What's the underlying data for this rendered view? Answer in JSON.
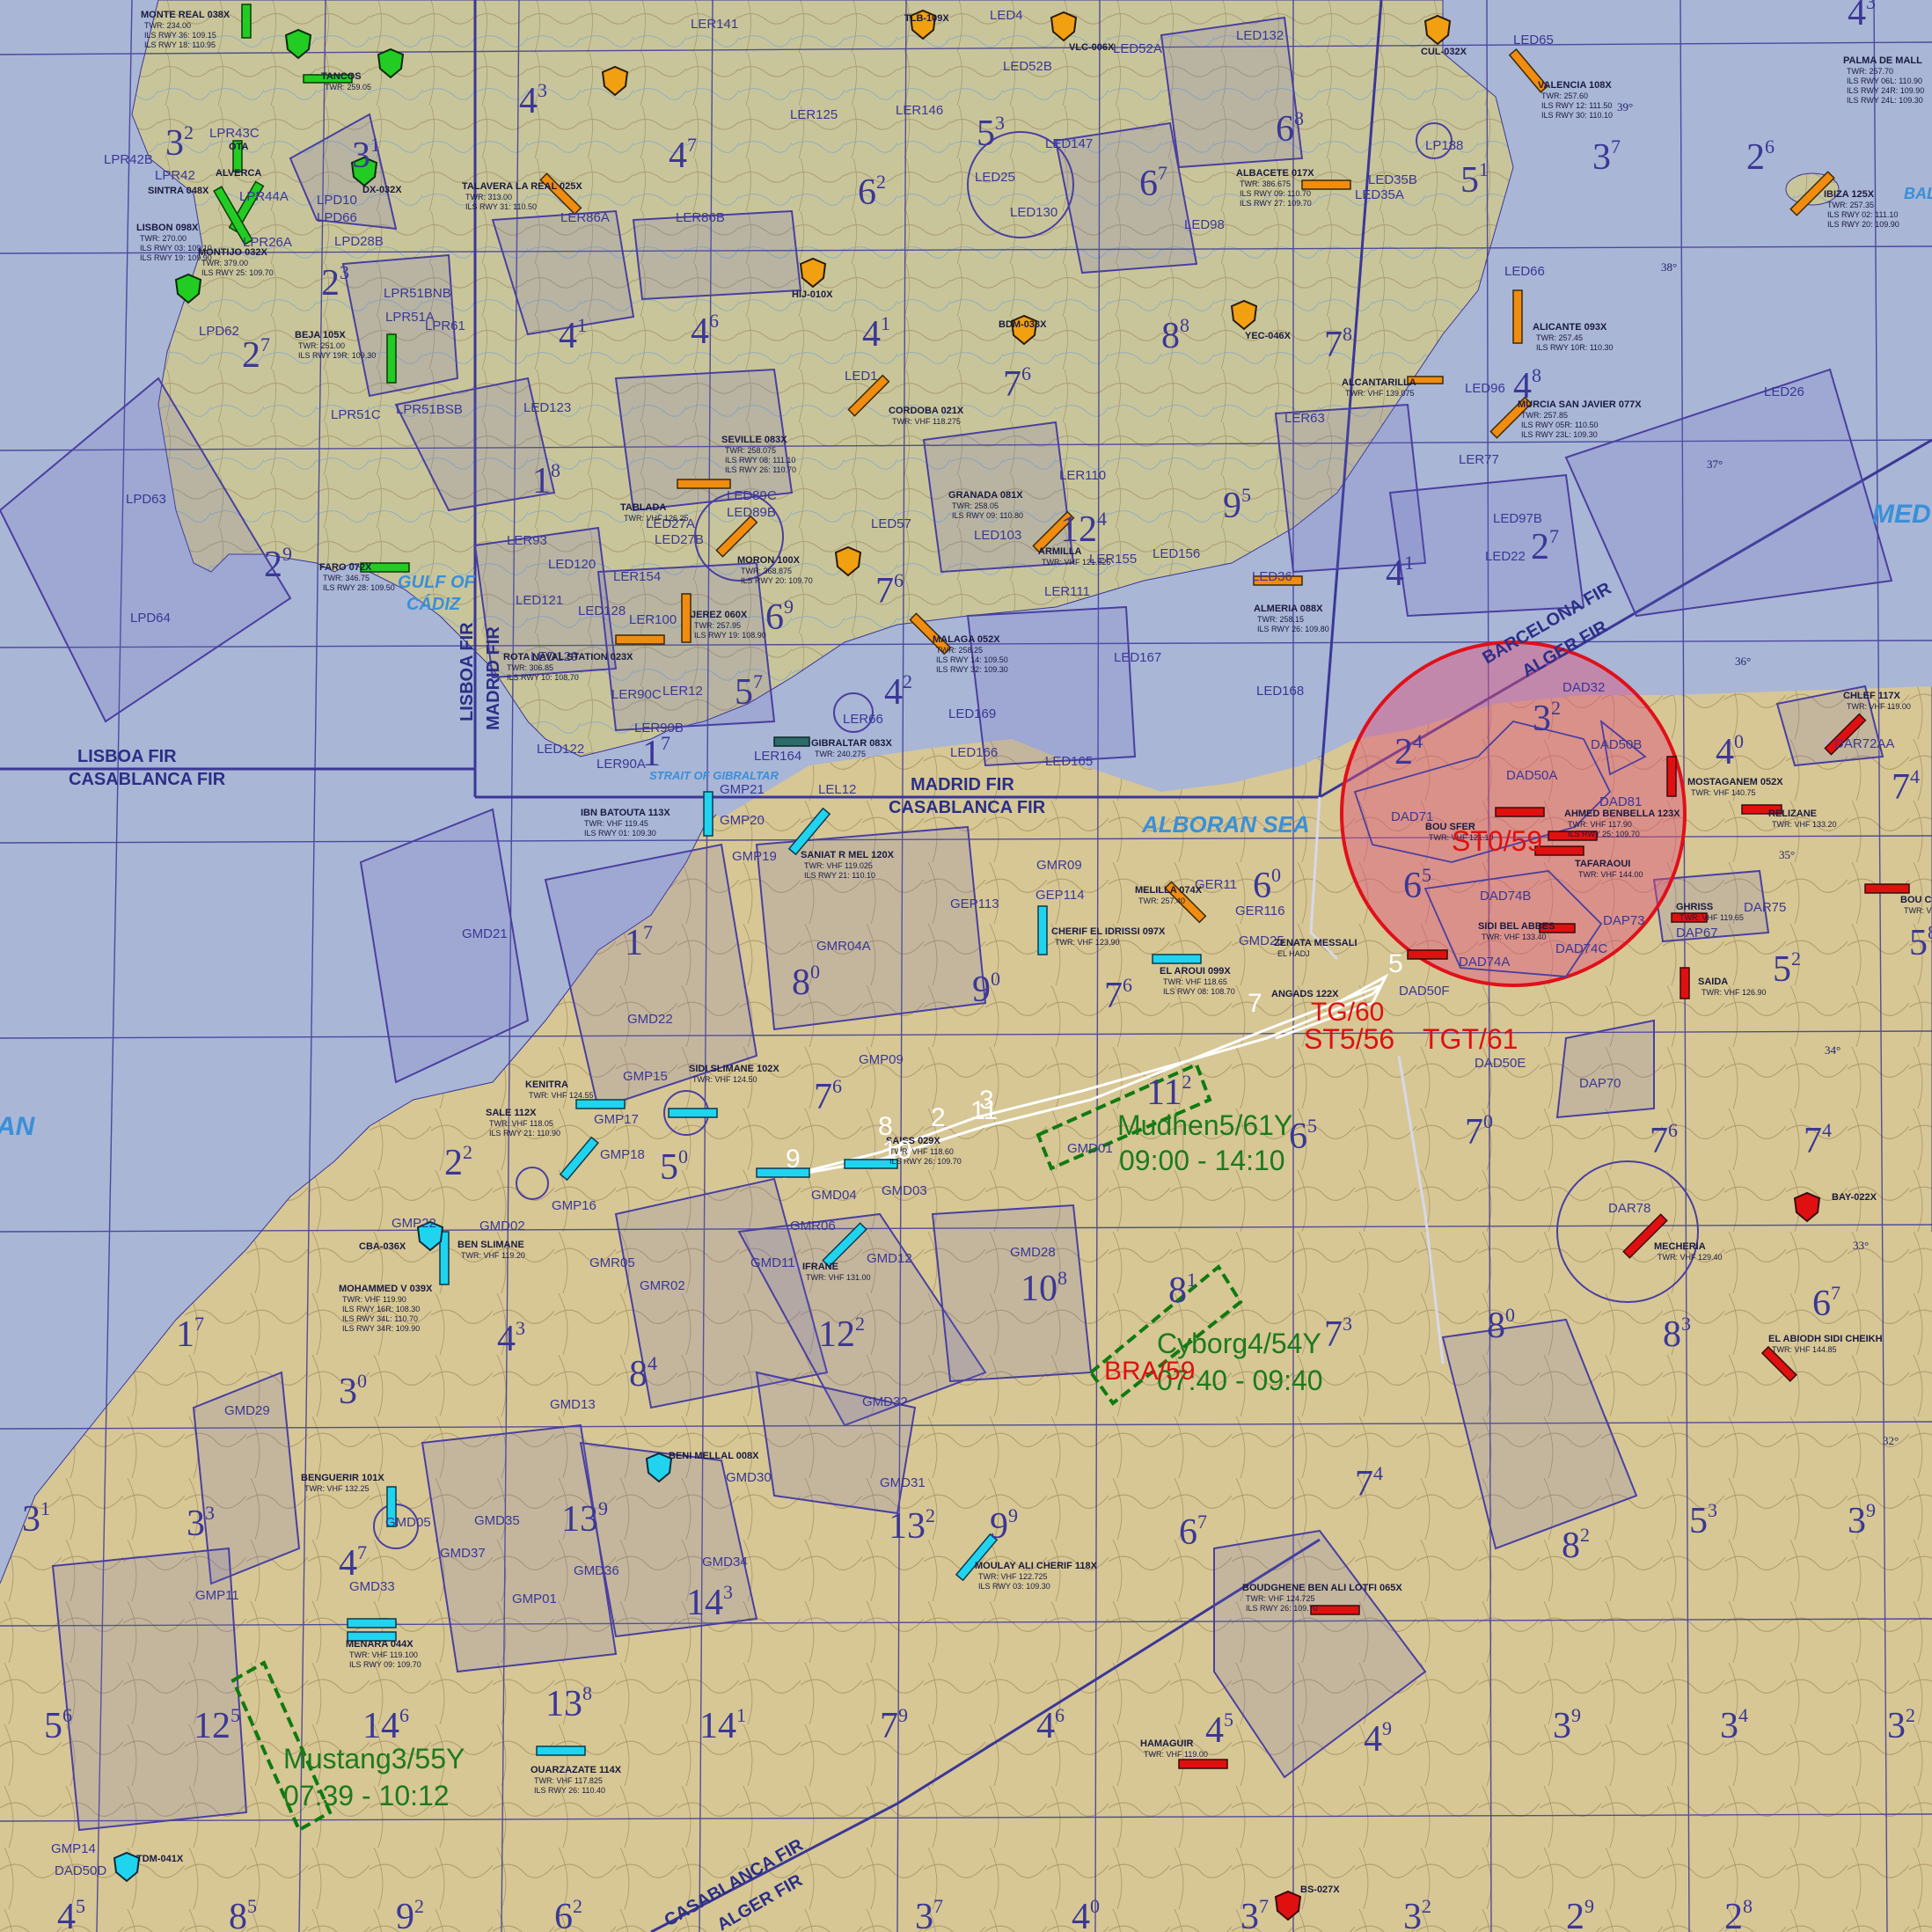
{
  "fir_labels": [
    {
      "id": "lisboa-fir",
      "text": "LISBOA FIR"
    },
    {
      "id": "casablanca-fir-w",
      "text": "CASABLANCA FIR"
    },
    {
      "id": "madrid-fir",
      "text": "MADRID FIR"
    },
    {
      "id": "casablanca-fir-c",
      "text": "CASABLANCA FIR"
    },
    {
      "id": "lisboa-fir-v",
      "text": "LISBOA FIR"
    },
    {
      "id": "madrid-fir-v",
      "text": "MADRID FIR"
    },
    {
      "id": "barcelona-fir",
      "text": "BARCELONA FIR"
    },
    {
      "id": "alger-fir",
      "text": "ALGER FIR"
    },
    {
      "id": "casablanca-fir-s",
      "text": "CASABLANCA FIR"
    },
    {
      "id": "alger-fir-s",
      "text": "ALGER FIR"
    }
  ],
  "sea_labels": [
    {
      "id": "gulf-of-cadiz-1",
      "text": "GULF OF"
    },
    {
      "id": "gulf-of-cadiz-2",
      "text": "CÁDIZ"
    },
    {
      "id": "alboran-sea",
      "text": "ALBORAN SEA"
    },
    {
      "id": "strait",
      "text": "STRAIT OF GIBRALTAR"
    },
    {
      "id": "med",
      "text": "MED"
    },
    {
      "id": "bal",
      "text": "BAL"
    },
    {
      "id": "atlantic",
      "text": "AN"
    }
  ],
  "latitudes": [
    "39°",
    "38°",
    "37°",
    "36°",
    "35°",
    "34°",
    "33°",
    "32°"
  ],
  "zones": [
    "LER141",
    "LED4",
    "LED52A",
    "LED132",
    "LED65",
    "LED52B",
    "LER125",
    "LER146",
    "LED147",
    "LP188",
    "LED35B",
    "LED35A",
    "LPR42B",
    "LPR43C",
    "LPR44A",
    "LPR42",
    "LPD10",
    "LPD66",
    "LPD28B",
    "LPR26A",
    "LER86A",
    "LER86B",
    "LED25",
    "LED130",
    "LED98",
    "LED66",
    "LPR51BNB",
    "LPR51A",
    "LPR61",
    "LPD62",
    "LPR51C",
    "LPR51BSB",
    "LED123",
    "LED1",
    "LER63",
    "LED26",
    "LED96",
    "LER77",
    "LPD63",
    "LPD64",
    "LED27A",
    "LED27B",
    "LED89C",
    "LED89B",
    "LED57",
    "LED103",
    "LER110",
    "LER155",
    "LED156",
    "LER111",
    "LED36",
    "LED97B",
    "LED22",
    "LER93",
    "LED120",
    "LER154",
    "LED121",
    "LED128",
    "LER100",
    "LED129",
    "LER12",
    "LER90C",
    "LER90B",
    "LED122",
    "LER90A",
    "LER164",
    "LER66",
    "LED169",
    "LED166",
    "LED165",
    "LED167",
    "LED168",
    "LEL12",
    "GMP21",
    "GMP20",
    "GMP19",
    "GMR09",
    "GEP113",
    "GEP114",
    "GER11",
    "GER116",
    "GMD25",
    "GMD21",
    "GMR04A",
    "GMD22",
    "GMP09",
    "GMP15",
    "GMP17",
    "GMP18",
    "GMP16",
    "GMP22",
    "GMD02",
    "GMD04",
    "GMD03",
    "GMD01",
    "GMR06",
    "GMR05",
    "GMR02",
    "GMD11",
    "GMD12",
    "GMD28",
    "GMD29",
    "GMD13",
    "GMD32",
    "GMD31",
    "GMD30",
    "GMD34",
    "GMD35",
    "GMD37",
    "GMD36",
    "GMP01",
    "GMD05",
    "GMD33",
    "GMP11",
    "GMP14",
    "DAD50D",
    "DAD32",
    "DAD50B",
    "DAD50A",
    "DAD71",
    "DAD81",
    "DAD74B",
    "DAD74A",
    "DAD74C",
    "DAP73",
    "DAD50F",
    "DAD50E",
    "DAP70",
    "DAR78",
    "DAR72AA",
    "DAR75",
    "DAP67"
  ],
  "airbases": [
    {
      "id": "monte-real",
      "text": "MONTE REAL 038X",
      "info": [
        "TWR: 234.00",
        "ILS RWY 36: 109.15",
        "ILS RWY 18: 110.95"
      ]
    },
    {
      "id": "sintra",
      "text": "SINTRA 048X"
    },
    {
      "id": "lisbon",
      "text": "LISBON 098X",
      "info": [
        "TWR: 270.00",
        "ILS RWY 03: 109.10",
        "ILS RWY 19: 109.90"
      ]
    },
    {
      "id": "montijo",
      "text": "MONTIJO 032X",
      "info": [
        "TWR: 379.00",
        "ILS RWY 25: 109.70"
      ]
    },
    {
      "id": "alverca",
      "text": "ALVERCA"
    },
    {
      "id": "ota",
      "text": "OTA"
    },
    {
      "id": "tancos",
      "text": "TANCOS",
      "info": [
        "TWR: 259.05"
      ]
    },
    {
      "id": "beja",
      "text": "BEJA 105X",
      "info": [
        "TWR: 251.00",
        "ILS RWY 19R: 109.30"
      ]
    },
    {
      "id": "faro",
      "text": "FARO 072X",
      "info": [
        "TWR: 346.75",
        "ILS RWY 28: 109.50"
      ]
    },
    {
      "id": "talavera",
      "text": "TALAVERA LA REAL 025X",
      "info": [
        "TWR: 313.00",
        "ILS RWY 31: 110.50"
      ]
    },
    {
      "id": "seville",
      "text": "SEVILLE 083X",
      "info": [
        "TWR: 258.075",
        "ILS RWY 08: 111.10",
        "ILS RWY 26: 110.70"
      ]
    },
    {
      "id": "tablada",
      "text": "TABLADA",
      "info": [
        "TWR: VHF 126.25"
      ]
    },
    {
      "id": "moron",
      "text": "MORON 100X",
      "info": [
        "TWR: 368.875",
        "ILS RWY 20: 109.70"
      ]
    },
    {
      "id": "jerez",
      "text": "JEREZ 060X",
      "info": [
        "TWR: 257.95",
        "ILS RWY 19: 108.90"
      ]
    },
    {
      "id": "rota",
      "text": "ROTA NAVAL STATION 023X",
      "info": [
        "TWR: 306.85",
        "ILS RWY 10: 108.70"
      ]
    },
    {
      "id": "cordoba",
      "text": "CORDOBA 021X",
      "info": [
        "TWR: VHF 118.275"
      ]
    },
    {
      "id": "granada",
      "text": "GRANADA 081X",
      "info": [
        "TWR: 258.05",
        "ILS RWY 09: 110.80"
      ]
    },
    {
      "id": "armilla",
      "text": "ARMILLA",
      "info": [
        "TWR: VHF 121.825"
      ]
    },
    {
      "id": "malaga",
      "text": "MALAGA 052X",
      "info": [
        "TWR: 258.25",
        "ILS RWY 14: 109.50",
        "ILS RWY 32: 109.30"
      ]
    },
    {
      "id": "almeria",
      "text": "ALMERIA 088X",
      "info": [
        "TWR: 258.15",
        "ILS RWY 26: 109.80"
      ]
    },
    {
      "id": "albacete",
      "text": "ALBACETE 017X",
      "info": [
        "TWR: 386.675",
        "ILS RWY 09: 110.70",
        "ILS RWY 27: 109.70"
      ]
    },
    {
      "id": "alcantarilla",
      "text": "ALCANTARILLA",
      "info": [
        "TWR: VHF 139.075"
      ]
    },
    {
      "id": "murcia",
      "text": "MURCIA SAN JAVIER 077X",
      "info": [
        "TWR: 257.85",
        "ILS RWY 05R: 110.50",
        "ILS RWY 23L: 109.30"
      ]
    },
    {
      "id": "alicante",
      "text": "ALICANTE 093X",
      "info": [
        "TWR: 257.45",
        "ILS RWY 10R: 110.30"
      ]
    },
    {
      "id": "valencia",
      "text": "VALENCIA 108X",
      "info": [
        "TWR: 257.60",
        "ILS RWY 12: 111.50",
        "ILS RWY 30: 110.10"
      ]
    },
    {
      "id": "palma",
      "text": "PALMA DE MALL",
      "info": [
        "TWR: 257.70",
        "ILS RWY 06L: 110.90",
        "ILS RWY 24R: 109.90",
        "ILS RWY 24L: 109.30"
      ]
    },
    {
      "id": "ibiza",
      "text": "IBIZA 125X",
      "info": [
        "TWR: 257.35",
        "ILS RWY 02: 111.10",
        "ILS RWY 20: 109.90"
      ]
    },
    {
      "id": "gibraltar",
      "text": "GIBRALTAR 083X",
      "info": [
        "TWR: 240.275"
      ]
    },
    {
      "id": "ibn-batouta",
      "text": "IBN BATOUTA 113X",
      "info": [
        "TWR: VHF 119.45",
        "ILS RWY 01: 109.30"
      ]
    },
    {
      "id": "saniat",
      "text": "SANIAT R MEL 120X",
      "info": [
        "TWR: VHF 119.025",
        "ILS RWY 21: 110.10"
      ]
    },
    {
      "id": "melilla",
      "text": "MELILLA 074X",
      "info": [
        "TWR: 257.40"
      ]
    },
    {
      "id": "cherif",
      "text": "CHERIF EL IDRISSI 097X",
      "info": [
        "TWR: VHF 123.90"
      ]
    },
    {
      "id": "el-aroui",
      "text": "EL AROUI 099X",
      "info": [
        "TWR: VHF 118.65",
        "ILS RWY 08: 108.70"
      ]
    },
    {
      "id": "angads",
      "text": "ANGADS 122X"
    },
    {
      "id": "zenata",
      "text": "ZENATA MESSALI",
      "info": [
        "EL HADJ"
      ]
    },
    {
      "id": "kenitra",
      "text": "KENITRA",
      "info": [
        "TWR: VHF 124.55"
      ]
    },
    {
      "id": "sidi-slimane",
      "text": "SIDI SLIMANE 102X",
      "info": [
        "TWR: VHF 124.50"
      ]
    },
    {
      "id": "sale",
      "text": "SALE 112X",
      "info": [
        "TWR: VHF 118.05",
        "ILS RWY 21: 110.90"
      ]
    },
    {
      "id": "fes",
      "text": "SAISS 029X",
      "info": [
        "TWR: VHF 118.60",
        "ILS RWY 26: 109.70"
      ]
    },
    {
      "id": "ifrane",
      "text": "IFRANE",
      "info": [
        "TWR: VHF 131.00"
      ]
    },
    {
      "id": "cba",
      "text": "CBA-036X"
    },
    {
      "id": "ben-slimane",
      "text": "BEN SLIMANE",
      "info": [
        "TWR: VHF 119.20"
      ]
    },
    {
      "id": "mohammed-v",
      "text": "MOHAMMED V 039X",
      "info": [
        "TWR: VHF 119.90",
        "ILS RWY 16R: 108.30",
        "ILS RWY 34L: 110.70",
        "ILS RWY 34R: 109.90"
      ]
    },
    {
      "id": "beni-mellal",
      "text": "BENI MELLAL 008X"
    },
    {
      "id": "benguerir",
      "text": "BENGUERIR 101X",
      "info": [
        "TWR: VHF 132.25"
      ]
    },
    {
      "id": "menara",
      "text": "MENARA 044X",
      "info": [
        "TWR: VHF 119.100",
        "ILS RWY 09: 109.70"
      ]
    },
    {
      "id": "ouarzazate",
      "text": "OUARZAZATE 114X",
      "info": [
        "TWR: VHF 117.825",
        "ILS RWY 26: 110.40"
      ]
    },
    {
      "id": "moulay-ali",
      "text": "MOULAY ALI CHERIF 118X",
      "info": [
        "TWR: VHF 122.725",
        "ILS RWY 03: 109.30"
      ]
    },
    {
      "id": "boudghene",
      "text": "BOUDGHENE BEN ALI LOTFI 065X",
      "info": [
        "TWR: VHF 124.725",
        "ILS RWY 26: 109.70"
      ]
    },
    {
      "id": "hamaguir",
      "text": "HAMAGUIR",
      "info": [
        "TWR: VHF 119.00"
      ]
    },
    {
      "id": "bou-sfer",
      "text": "BOU SFER",
      "info": [
        "TWR: VHF 121.10"
      ]
    },
    {
      "id": "ahmed-ben-bella",
      "text": "AHMED BENBELLA 123X",
      "info": [
        "TWR: VHF 117.90",
        "ILS RWY 25: 109.70"
      ]
    },
    {
      "id": "tafaraoui",
      "text": "TAFARAOUI",
      "info": [
        "TWR: VHF 144.00"
      ]
    },
    {
      "id": "sidi-bel-abbes",
      "text": "SIDI BEL ABBES",
      "info": [
        "TWR: VHF 133.40"
      ]
    },
    {
      "id": "mostaganem",
      "text": "MOSTAGANEM 052X",
      "info": [
        "TWR: VHF 140.75"
      ]
    },
    {
      "id": "relizane",
      "text": "RELIZANE",
      "info": [
        "TWR: VHF 133.20"
      ]
    },
    {
      "id": "chlef",
      "text": "CHLEF 117X",
      "info": [
        "TWR: VHF 119.00"
      ]
    },
    {
      "id": "ghriss",
      "text": "GHRISS",
      "info": [
        "TWR: VHF 119.65"
      ]
    },
    {
      "id": "saida",
      "text": "SAIDA",
      "info": [
        "TWR: VHF 126.90"
      ]
    },
    {
      "id": "mecheria",
      "text": "MECHERIA",
      "info": [
        "TWR: VHF 129.40"
      ]
    },
    {
      "id": "el-abiodh",
      "text": "EL ABIODH SIDI CHEIKH",
      "info": [
        "TWR: VHF 144.85"
      ]
    },
    {
      "id": "bou-chekif",
      "text": "BOU C",
      "info": [
        "TWR: VHF"
      ]
    },
    {
      "id": "bay",
      "text": "BAY-022X"
    },
    {
      "id": "tmn",
      "text": "TDM-041X"
    },
    {
      "id": "bs",
      "text": "BS-027X"
    },
    {
      "id": "cul",
      "text": "CUL-032X"
    },
    {
      "id": "rkt",
      "text": "TLB-109X"
    },
    {
      "id": "vlc",
      "text": "VLC-006X"
    },
    {
      "id": "dx",
      "text": "DX-032X"
    },
    {
      "id": "hij",
      "text": "HIJ-010X"
    },
    {
      "id": "bdm",
      "text": "BDM-033X"
    },
    {
      "id": "yec",
      "text": "YEC-046X"
    }
  ],
  "flights": [
    {
      "id": "mudhen",
      "name": "Mudhen5/61Y",
      "time": "09:00 - 14:10"
    },
    {
      "id": "cyborg",
      "name": "Cyborg4/54Y",
      "time": "07:40 - 09:40"
    },
    {
      "id": "mustang",
      "name": "Mustang3/55Y",
      "time": "07:39 - 10:12"
    }
  ],
  "threats": {
    "sam_label": "ST0/59",
    "target": "TGT/61",
    "st": "ST5/56",
    "bra": "BRA/59",
    "tg60": "TG/60"
  },
  "route_numbers": [
    "9",
    "8",
    "10",
    "2",
    "3",
    "11",
    "7",
    "5"
  ],
  "colors": {
    "sea": "#a9b6d6",
    "land": "#c9c597",
    "line": "#3b3796",
    "friendly_green": "#22cc22",
    "friendly_cyan": "#20d4f0",
    "neutral_orange": "#f08c10",
    "hostile_red": "#e01010"
  }
}
